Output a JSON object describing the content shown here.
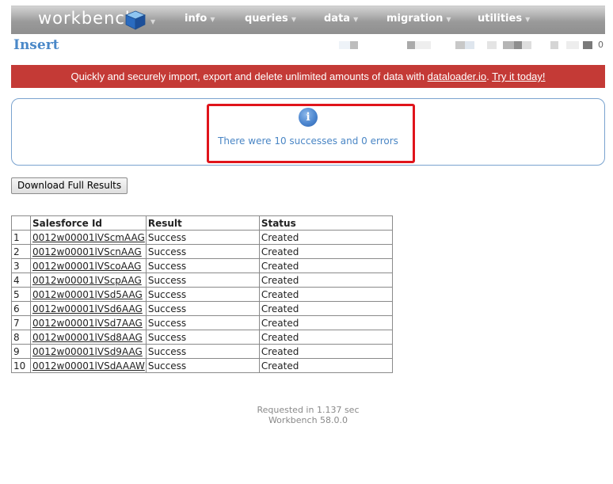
{
  "nav": {
    "brand": "workbench",
    "brand_icon": "cube-logo-icon",
    "items": [
      {
        "label": "info"
      },
      {
        "label": "queries"
      },
      {
        "label": "data"
      },
      {
        "label": "migration"
      },
      {
        "label": "utilities"
      }
    ],
    "caret_icon": "chevron-down-icon"
  },
  "header": {
    "title": "Insert",
    "user_info_suffix": "0"
  },
  "banner": {
    "text": "Quickly and securely import, export and delete unlimited amounts of data with ",
    "link_label": "dataloader.io",
    "separator": ". ",
    "cta_label": "Try it today!",
    "color": "#c43a36"
  },
  "info": {
    "icon": "info-icon",
    "icon_glyph": "i",
    "message": "There were 10 successes and 0 errors",
    "highlight_color": "#e0141b"
  },
  "actions": {
    "download_label": "Download Full Results"
  },
  "results_table": {
    "headers": [
      "",
      "Salesforce Id",
      "Result",
      "Status"
    ],
    "rows": [
      {
        "num": "1",
        "id": "0012w00001lVScmAAG",
        "result": "Success",
        "status": "Created"
      },
      {
        "num": "2",
        "id": "0012w00001lVScnAAG",
        "result": "Success",
        "status": "Created"
      },
      {
        "num": "3",
        "id": "0012w00001lVScoAAG",
        "result": "Success",
        "status": "Created"
      },
      {
        "num": "4",
        "id": "0012w00001lVScpAAG",
        "result": "Success",
        "status": "Created"
      },
      {
        "num": "5",
        "id": "0012w00001lVSd5AAG",
        "result": "Success",
        "status": "Created"
      },
      {
        "num": "6",
        "id": "0012w00001lVSd6AAG",
        "result": "Success",
        "status": "Created"
      },
      {
        "num": "7",
        "id": "0012w00001lVSd7AAG",
        "result": "Success",
        "status": "Created"
      },
      {
        "num": "8",
        "id": "0012w00001lVSd8AAG",
        "result": "Success",
        "status": "Created"
      },
      {
        "num": "9",
        "id": "0012w00001lVSd9AAG",
        "result": "Success",
        "status": "Created"
      },
      {
        "num": "10",
        "id": "0012w00001lVSdAAAW",
        "result": "Success",
        "status": "Created"
      }
    ]
  },
  "footer": {
    "timing": "Requested in 1.137 sec",
    "version": "Workbench 58.0.0"
  }
}
